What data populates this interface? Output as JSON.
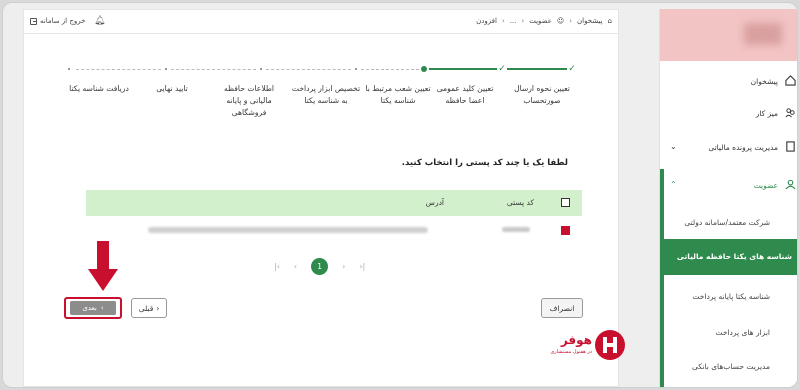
{
  "topbar": {
    "logout_label": "خروج از سامانه",
    "breadcrumbs": [
      "پیشخوان",
      "عضویت",
      "...",
      "افزودن"
    ]
  },
  "steps": [
    {
      "label": "تعیین نحوه ارسال صورتحساب",
      "status": "done"
    },
    {
      "label": "تعیین کلید عمومی اعضا حافظه",
      "status": "done"
    },
    {
      "label": "تعیین شعب مرتبط با شناسه یکتا",
      "status": "current"
    },
    {
      "label": "تخصیص ابزار پرداخت به شناسه یکتا",
      "status": "pending"
    },
    {
      "label": "اطلاعات حافظه مالیاتی و پایانه فروشگاهی",
      "status": "pending"
    },
    {
      "label": "تایید نهایی",
      "status": "pending"
    },
    {
      "label": "دریافت شناسه یکتا",
      "status": "pending"
    }
  ],
  "prompt": "لطفا یک یا چند کد پستی را انتخاب کنید.",
  "table": {
    "headers": {
      "postal_code": "کد پستی",
      "address": "آدرس"
    }
  },
  "pagination": {
    "current_page": "1"
  },
  "buttons": {
    "next": "بعدی",
    "prev": "قبلی",
    "cancel": "انصراف"
  },
  "brand": {
    "name": "هوفر",
    "tagline": "در هفتول مستشاری"
  },
  "sidebar": {
    "items": [
      {
        "label": "پیشخوان"
      },
      {
        "label": "میز کار"
      },
      {
        "label": "مدیریت پرونده مالیاتی"
      },
      {
        "label": "عضویت"
      }
    ],
    "sub_items": [
      {
        "label": "شرکت معتمد/سامانه دولتی"
      },
      {
        "label": "شناسه های یکتا حافظه مالیاتی"
      },
      {
        "label": "شناسه یکتا پایانه پرداخت"
      },
      {
        "label": "ابزار های پرداخت"
      },
      {
        "label": "مدیریت حساب‌های بانکی"
      }
    ]
  },
  "colors": {
    "accent": "#2e8b4d",
    "alert": "#c8102e",
    "header_green": "#d3f0cd"
  }
}
